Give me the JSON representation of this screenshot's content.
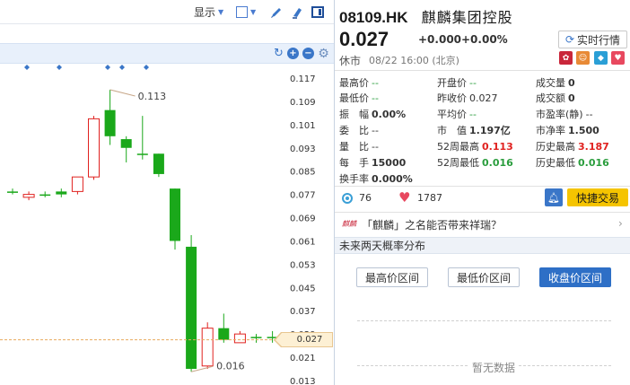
{
  "toolbar": {
    "display_label": "显示"
  },
  "stock": {
    "code": "08109.HK",
    "name": "麒麟集团控股",
    "price": "0.027",
    "change": "+0.000",
    "change_pct": "+0.00%",
    "status": "休市",
    "time": "08/22 16:00 (北京)",
    "realtime_button": "实时行情"
  },
  "stats": {
    "high": {
      "label": "最高价",
      "value": "--"
    },
    "low": {
      "label": "最低价",
      "value": "--"
    },
    "amplitude": {
      "label": "振　幅",
      "value": "0.00%"
    },
    "bid_ratio": {
      "label": "委　比",
      "value": "--"
    },
    "volume_ratio": {
      "label": "量　比",
      "value": "--"
    },
    "lot_size": {
      "label": "每　手",
      "value": "15000"
    },
    "turnover_rate": {
      "label": "换手率",
      "value": "0.000%"
    },
    "open": {
      "label": "开盘价",
      "value": "--"
    },
    "prev_close": {
      "label": "昨收价",
      "value": "0.027"
    },
    "avg_price": {
      "label": "平均价",
      "value": "--"
    },
    "market_cap": {
      "label": "市　值",
      "value": "1.197亿"
    },
    "high_52w": {
      "label": "52周最高",
      "value": "0.113"
    },
    "low_52w": {
      "label": "52周最低",
      "value": "0.016"
    },
    "volume": {
      "label": "成交量",
      "value": "0"
    },
    "amount": {
      "label": "成交额",
      "value": "0"
    },
    "pe_static": {
      "label": "市盈率(静)",
      "value": "--"
    },
    "pb": {
      "label": "市净率",
      "value": "1.500"
    },
    "hist_high": {
      "label": "历史最高",
      "value": "3.187"
    },
    "hist_low": {
      "label": "历史最低",
      "value": "0.016"
    }
  },
  "social": {
    "views": "76",
    "likes": "1787",
    "quick_trade": "快捷交易"
  },
  "news": {
    "icon_text": "麒麟",
    "headline": "「麒麟」之名能否带来祥瑞？"
  },
  "forecast": {
    "title": "未来两天概率分布",
    "btn_high": "最高价区间",
    "btn_low": "最低价区间",
    "btn_close": "收盘价区间",
    "no_data": "暂无数据"
  },
  "chart_data": {
    "type": "candlestick",
    "y_ticks": [
      "0.117",
      "0.109",
      "0.101",
      "0.093",
      "0.085",
      "0.077",
      "0.069",
      "0.061",
      "0.053",
      "0.045",
      "0.037",
      "0.029",
      "0.021",
      "0.013"
    ],
    "ylim": [
      0.013,
      0.117
    ],
    "high_annotation": "0.113",
    "low_annotation": "0.016",
    "last_price_label": "0.027",
    "candles": [
      {
        "o": 0.078,
        "h": 0.079,
        "l": 0.077,
        "c": 0.078,
        "dir": "down"
      },
      {
        "o": 0.076,
        "h": 0.078,
        "l": 0.075,
        "c": 0.077,
        "dir": "up"
      },
      {
        "o": 0.077,
        "h": 0.078,
        "l": 0.076,
        "c": 0.077,
        "dir": "down"
      },
      {
        "o": 0.078,
        "h": 0.079,
        "l": 0.076,
        "c": 0.077,
        "dir": "down"
      },
      {
        "o": 0.078,
        "h": 0.083,
        "l": 0.077,
        "c": 0.083,
        "dir": "up"
      },
      {
        "o": 0.083,
        "h": 0.104,
        "l": 0.082,
        "c": 0.103,
        "dir": "up"
      },
      {
        "o": 0.106,
        "h": 0.113,
        "l": 0.094,
        "c": 0.097,
        "dir": "down"
      },
      {
        "o": 0.096,
        "h": 0.097,
        "l": 0.088,
        "c": 0.093,
        "dir": "down"
      },
      {
        "o": 0.091,
        "h": 0.104,
        "l": 0.089,
        "c": 0.091,
        "dir": "down"
      },
      {
        "o": 0.091,
        "h": 0.091,
        "l": 0.083,
        "c": 0.084,
        "dir": "down"
      },
      {
        "o": 0.079,
        "h": 0.079,
        "l": 0.058,
        "c": 0.061,
        "dir": "down"
      },
      {
        "o": 0.059,
        "h": 0.063,
        "l": 0.016,
        "c": 0.017,
        "dir": "down"
      },
      {
        "o": 0.018,
        "h": 0.033,
        "l": 0.017,
        "c": 0.031,
        "dir": "up"
      },
      {
        "o": 0.031,
        "h": 0.036,
        "l": 0.026,
        "c": 0.027,
        "dir": "down"
      },
      {
        "o": 0.026,
        "h": 0.03,
        "l": 0.026,
        "c": 0.029,
        "dir": "up"
      },
      {
        "o": 0.028,
        "h": 0.029,
        "l": 0.026,
        "c": 0.028,
        "dir": "down"
      },
      {
        "o": 0.028,
        "h": 0.03,
        "l": 0.026,
        "c": 0.028,
        "dir": "down"
      },
      {
        "o": 0.028,
        "h": 0.028,
        "l": 0.027,
        "c": 0.027,
        "dir": "down"
      }
    ]
  },
  "colors": {
    "up": "#e0211f",
    "down": "#1aa81a",
    "accent": "#3a76c8",
    "trade_button": "#f5c400"
  }
}
